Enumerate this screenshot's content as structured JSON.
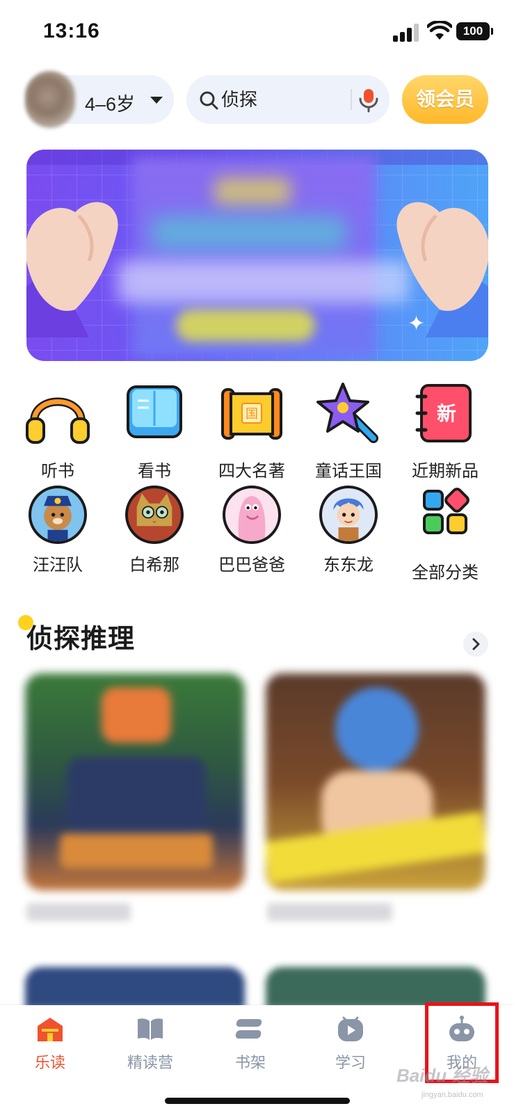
{
  "status_bar": {
    "time": "13:16",
    "battery": "100"
  },
  "header": {
    "age_label": "4–6岁",
    "search_placeholder": "侦探",
    "vip_label": "领会员"
  },
  "categories_row1": [
    {
      "label": "听书",
      "icon": "headphones-icon"
    },
    {
      "label": "看书",
      "icon": "open-book-icon"
    },
    {
      "label": "四大名著",
      "icon": "scroll-icon",
      "badge": "国"
    },
    {
      "label": "童话王国",
      "icon": "magic-wand-icon"
    },
    {
      "label": "近期新品",
      "icon": "new-notebook-icon",
      "badge": "新"
    }
  ],
  "categories_row2": [
    {
      "label": "汪汪队",
      "icon": "paw-patrol-avatar-icon"
    },
    {
      "label": "白希那",
      "icon": "cat-avatar-icon"
    },
    {
      "label": "巴巴爸爸",
      "icon": "barbapapa-avatar-icon"
    },
    {
      "label": "东东龙",
      "icon": "dragon-boy-avatar-icon"
    },
    {
      "label": "全部分类",
      "icon": "all-categories-grid-icon"
    }
  ],
  "section": {
    "title": "侦探推理"
  },
  "tabbar": [
    {
      "label": "乐读",
      "icon": "home-icon",
      "active": true
    },
    {
      "label": "精读营",
      "icon": "book-icon",
      "active": false
    },
    {
      "label": "书架",
      "icon": "bookshelf-icon",
      "active": false
    },
    {
      "label": "学习",
      "icon": "play-icon",
      "active": false
    },
    {
      "label": "我的",
      "icon": "robot-profile-icon",
      "active": false
    }
  ],
  "colors": {
    "accent": "#f0522e",
    "vip_gold": "#ffb82a",
    "tab_inactive": "#8a95a8",
    "highlight": "#e8131a"
  }
}
